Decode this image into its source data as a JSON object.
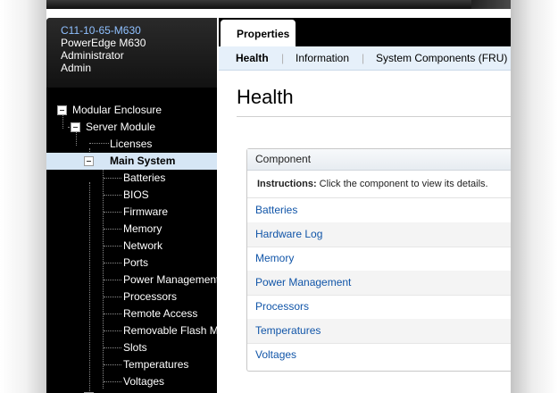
{
  "system": {
    "hostname": "C11-10-65-M630",
    "model": "PowerEdge M630",
    "user": "Administrator",
    "role": "Admin"
  },
  "tree": {
    "root": "Modular Enclosure",
    "server_module": "Server Module",
    "licenses": "Licenses",
    "main_system": "Main System",
    "children": [
      "Batteries",
      "BIOS",
      "Firmware",
      "Memory",
      "Network",
      "Ports",
      "Power Management",
      "Processors",
      "Remote Access",
      "Removable Flash Media",
      "Slots",
      "Temperatures",
      "Voltages"
    ]
  },
  "tabs": {
    "properties": "Properties",
    "health": "Health",
    "information": "Information",
    "system_components": "System Components (FRU)"
  },
  "page": {
    "title": "Health",
    "table_header": "Component",
    "instructions_label": "Instructions:",
    "instructions_text": " Click the component to view its details.",
    "components": [
      "Batteries",
      "Hardware Log",
      "Memory",
      "Power Management",
      "Processors",
      "Temperatures",
      "Voltages"
    ]
  },
  "colors": {
    "link": "#1155a8",
    "hostname": "#8fc0ff",
    "selected_node": "#d6e6f5"
  }
}
